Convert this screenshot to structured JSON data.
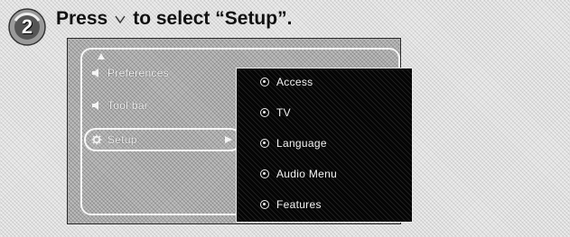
{
  "step": {
    "number": "2"
  },
  "instruction": {
    "prefix": "Press",
    "key_icon": "down-arrow-key-icon",
    "suffix": "to select “Setup”."
  },
  "menu": {
    "left_items": [
      {
        "label": "Preferences",
        "icon": "sound-icon"
      },
      {
        "label": "Tool bar",
        "icon": "sound-icon"
      },
      {
        "label": "Setup",
        "icon": "gear-icon",
        "selected": true
      }
    ],
    "submenu": [
      {
        "label": "Access"
      },
      {
        "label": "TV"
      },
      {
        "label": "Language"
      },
      {
        "label": "Audio Menu"
      },
      {
        "label": "Features"
      }
    ]
  },
  "colors": {
    "page_background": "#ececec",
    "submenu_background": "#050505",
    "menu_text": "#f4f4f4",
    "frame_border": "#f7f7f7"
  }
}
